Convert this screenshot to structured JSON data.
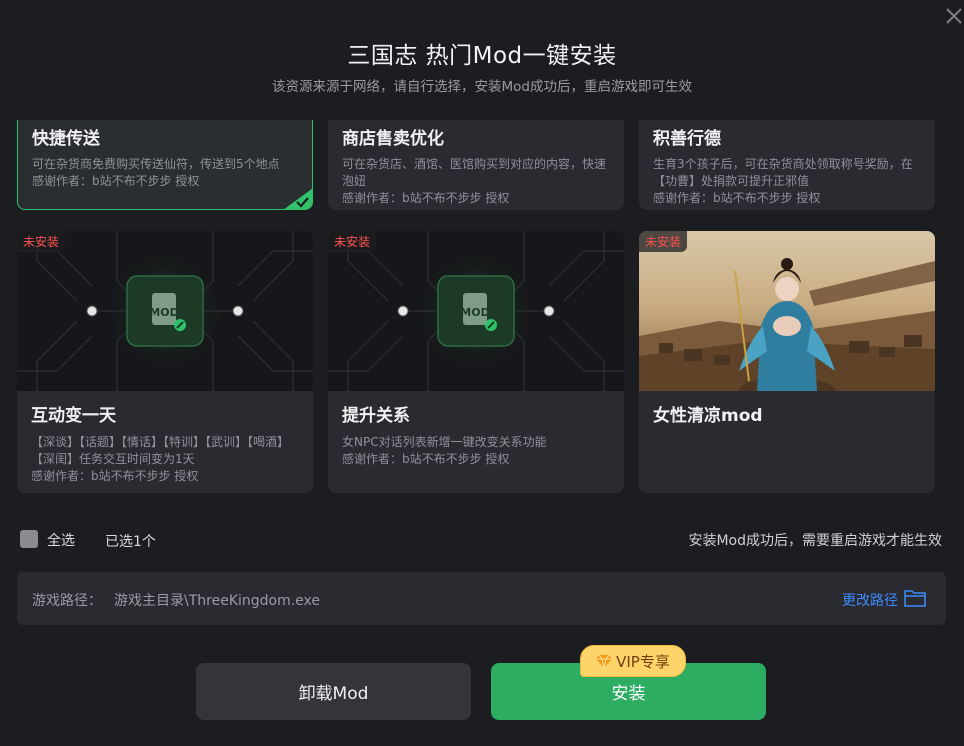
{
  "header": {
    "title": "三国志 热门Mod一键安装",
    "subtitle": "该资源来源于网络，请自行选择，安装Mod成功后，重启游戏即可生效"
  },
  "top_cards": [
    {
      "name": "快捷传送",
      "desc": "可在杂货商免费购买传送仙符，传送到5个地点",
      "author": "感谢作者：b站不布不步步 授权",
      "selected": true
    },
    {
      "name": "商店售卖优化",
      "desc": "可在杂货店、酒馆、医馆购买到对应的内容，快速泡妞",
      "author": "感谢作者：b站不布不步步 授权",
      "selected": false
    },
    {
      "name": "积善行德",
      "desc": "生育3个孩子后，可在杂货商处领取称号奖励，在【功曹】处捐款可提升正邪值",
      "author": "感谢作者：b站不布不步步 授权",
      "selected": false
    }
  ],
  "cards": [
    {
      "badge": "未安装",
      "name": "互动变一天",
      "desc": "【深谈】【话题】【情话】【特训】【武训】【喝酒】【深闺】任务交互时间变为1天",
      "author": "感谢作者：b站不布不步步 授权",
      "thumb_label": "MOD"
    },
    {
      "badge": "未安装",
      "name": "提升关系",
      "desc": "女NPC对话列表新增一键改变关系功能",
      "author": "感谢作者：b站不布不步步 授权",
      "thumb_label": "MOD"
    },
    {
      "badge": "未安装",
      "name": "女性清凉mod",
      "desc": "",
      "author": ""
    }
  ],
  "footer": {
    "select_all": "全选",
    "selected_count": "已选1个",
    "note": "安装Mod成功后，需要重启游戏才能生效"
  },
  "path": {
    "label": "游戏路径：",
    "value": "游戏主目录\\ThreeKingdom.exe",
    "change": "更改路径"
  },
  "buttons": {
    "uninstall": "卸载Mod",
    "install": "安装",
    "vip": "VIP专享"
  },
  "colors": {
    "accent_green": "#2cad62",
    "link_blue": "#3d8bff",
    "badge_red": "#ff5252",
    "vip_gold": "#fcd46a"
  }
}
